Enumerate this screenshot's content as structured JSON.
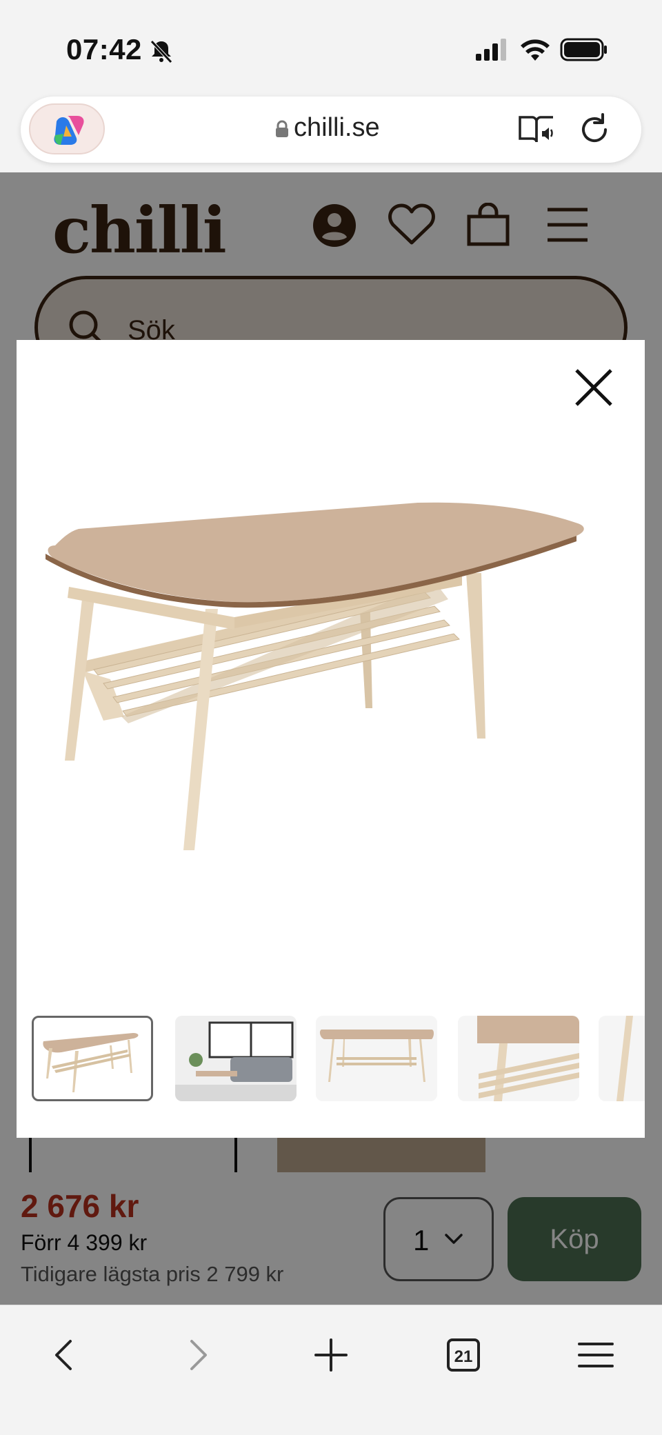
{
  "status_bar": {
    "time": "07:42",
    "icons": [
      "bell-slash-icon",
      "signal-icon",
      "wifi-icon",
      "battery-icon"
    ]
  },
  "browser": {
    "url": "chilli.se",
    "tab_count": "21",
    "icons": [
      "copilot-icon",
      "lock-icon",
      "reader-mode-icon",
      "reload-icon",
      "back-icon",
      "forward-icon",
      "new-tab-icon",
      "tabs-icon",
      "menu-icon"
    ]
  },
  "site": {
    "logo": "chilli",
    "search_placeholder": "Sök",
    "header_icons": [
      "account-icon",
      "heart-icon",
      "bag-icon",
      "hamburger-icon"
    ]
  },
  "product": {
    "price": "2 676 kr",
    "previous_price": "Förr 4 399 kr",
    "lowest_price": "Tidigare lägsta pris 2 799 kr",
    "quantity": "1",
    "buy_label": "Köp"
  },
  "gallery": {
    "thumbnail_count": 5,
    "selected_index": 0
  },
  "colors": {
    "brand_brown": "#3b2412",
    "price_red": "#b8301e",
    "buy_green": "#4e7054"
  }
}
